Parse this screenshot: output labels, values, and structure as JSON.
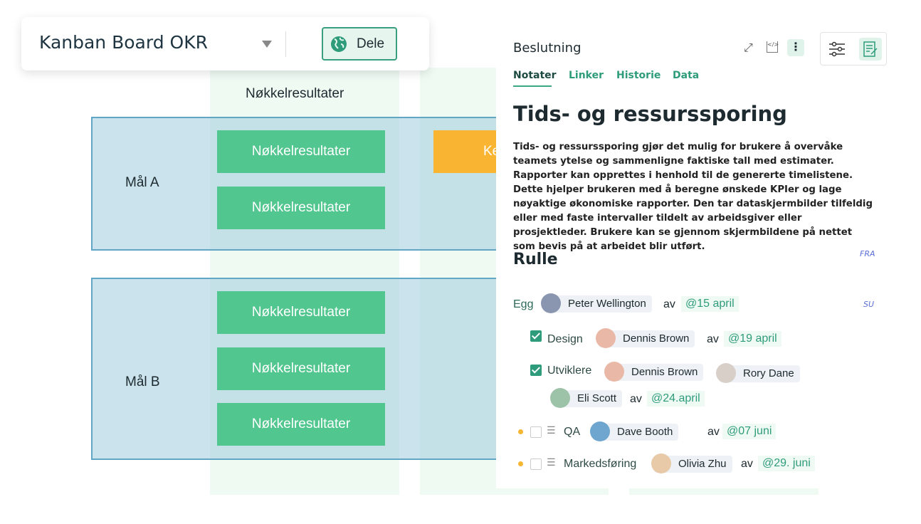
{
  "header": {
    "title": "Kanban Board OKR",
    "share_label": "Dele"
  },
  "board": {
    "column_header": "Nøkkelresultater",
    "goals": [
      {
        "label": "Mål A",
        "cards": [
          "Nøkkelresultater",
          "Nøkkelresultater"
        ],
        "side_card": "Ke"
      },
      {
        "label": "Mål B",
        "cards": [
          "Nøkkelresultater",
          "Nøkkelresultater",
          "Nøkkelresultater"
        ]
      }
    ]
  },
  "panel": {
    "title": "Beslutning",
    "tabs": [
      "Notater",
      "Linker",
      "Historie",
      "Data"
    ],
    "active_tab": "Notater",
    "heading": "Tids- og ressurssporing",
    "body": "Tids- og ressurssporing gjør det mulig for brukere å overvåke teamets ytelse og sammenligne faktiske tall med estimater. Rapporter kan opprettes i henhold til de genererte timelistene. Dette hjelper brukeren med å beregne ønskede KPIer og lage nøyaktige økonomiske rapporter. Den tar dataskjermbilder tilfeldig eller med faste intervaller tildelt av arbeidsgiver eller prosjektleder. Brukere kan se gjennom skjermbildene på nettet som bevis på at arbeidet blir utført.",
    "section": "Rulle",
    "tag_fra": "FRA",
    "tag_su": "SU",
    "by": "av",
    "roles": [
      {
        "name": "Egg",
        "people": [
          "Peter Wellington"
        ],
        "date": "@15 april"
      },
      {
        "name": "Design",
        "checked": true,
        "people": [
          "Dennis Brown"
        ],
        "date": "@19 april"
      },
      {
        "name": "Utviklere",
        "checked": true,
        "people": [
          "Dennis Brown",
          "Rory Dane",
          "Eli Scott"
        ],
        "date": "@24.april"
      },
      {
        "name": "QA",
        "checked": false,
        "people": [
          "Dave Booth"
        ],
        "date": "@07 juni"
      },
      {
        "name": "Markedsføring",
        "checked": false,
        "people": [
          "Olivia Zhu"
        ],
        "date": "@29. juni"
      }
    ]
  },
  "colors": {
    "accent": "#2e9c7a",
    "card": "#52c68f",
    "orange": "#f9b531",
    "row": "#c5e0e8"
  }
}
